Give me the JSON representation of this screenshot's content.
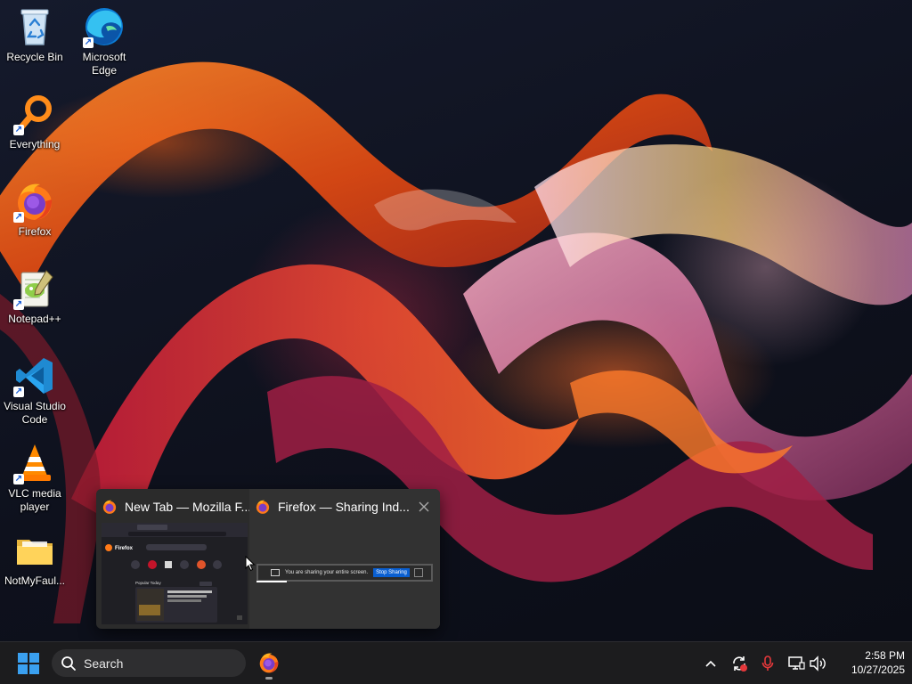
{
  "desktop": {
    "icons": [
      {
        "label": "Recycle Bin",
        "icon": "recycle-bin-icon"
      },
      {
        "label": "Microsoft Edge",
        "icon": "edge-icon"
      },
      {
        "label": "Everything",
        "icon": "everything-search-icon"
      },
      {
        "label": "Firefox",
        "icon": "firefox-icon"
      },
      {
        "label": "Notepad++",
        "icon": "notepad-plus-plus-icon"
      },
      {
        "label": "Visual Studio Code",
        "icon": "vscode-icon"
      },
      {
        "label": "VLC media player",
        "icon": "vlc-icon"
      },
      {
        "label": "NotMyFaul...",
        "icon": "folder-icon"
      }
    ]
  },
  "thumbnail_preview": {
    "windows": [
      {
        "title": "New Tab — Mozilla F...",
        "preview": {
          "browser_name": "Firefox",
          "section_label": "Popular Today"
        }
      },
      {
        "title": "Firefox — Sharing Ind...",
        "preview": {
          "sharing_message": "You are sharing your entire screen.",
          "stop_label": "Stop Sharing"
        }
      }
    ]
  },
  "taskbar": {
    "search_label": "Search",
    "pinned": [
      {
        "name": "Firefox",
        "icon": "firefox-icon",
        "running": true
      }
    ],
    "tray_icons": [
      "chevron-up-icon",
      "sync-alert-icon",
      "microphone-icon",
      "network-icon",
      "volume-icon"
    ],
    "clock": {
      "time": "2:58 PM",
      "date": "10/27/2025"
    }
  },
  "colors": {
    "taskbar_bg": "#1c1c1e",
    "accent": "#0a5fd1",
    "recording_red": "#e5383b",
    "start_blue": "#3aa0f0"
  }
}
